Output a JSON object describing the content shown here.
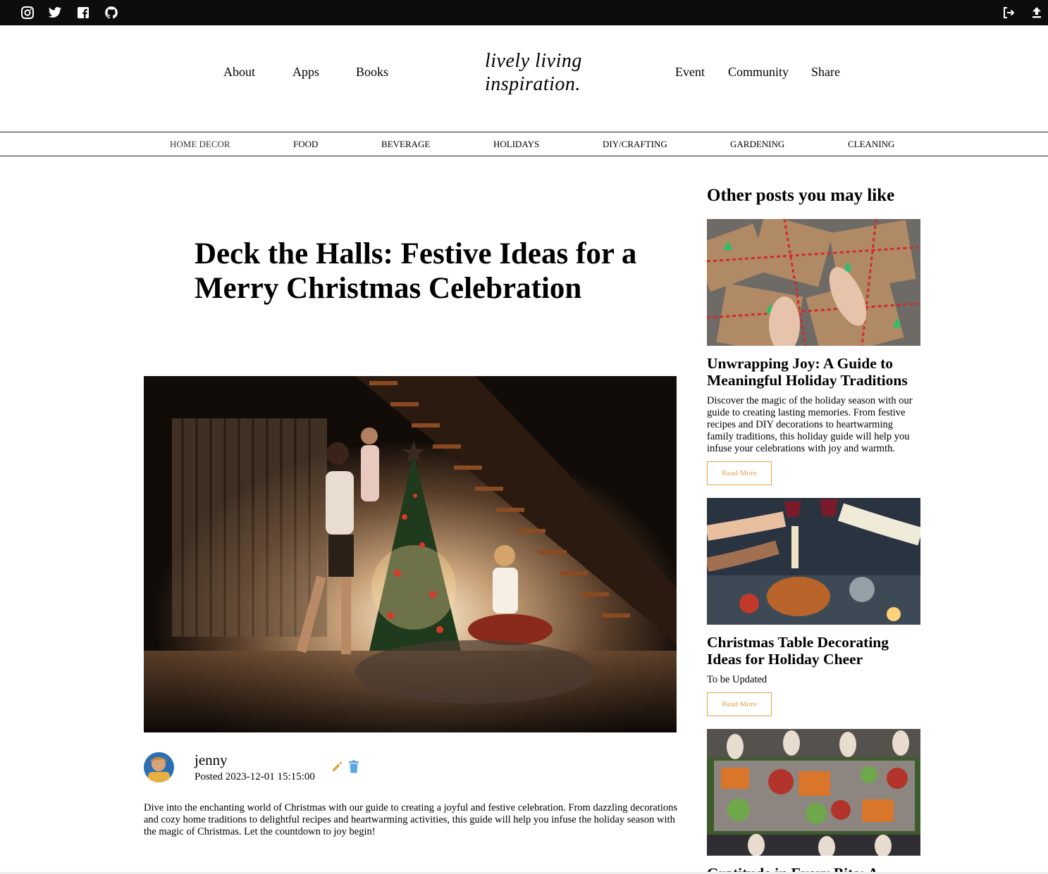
{
  "topbar": {
    "social_icons": [
      "instagram-icon",
      "twitter-icon",
      "facebook-icon",
      "github-icon"
    ],
    "right_icons": [
      "logout-icon",
      "upload-icon"
    ]
  },
  "header": {
    "nav_left": [
      "About",
      "Apps",
      "Books"
    ],
    "logo_line1": "lively living",
    "logo_line2": "inspiration.",
    "nav_right": [
      "Event",
      "Community",
      "Share"
    ]
  },
  "categories": [
    "HOME DECOR",
    "FOOD",
    "BEVERAGE",
    "HOLIDAYS",
    "DIY/CRAFTING",
    "GARDENING",
    "CLEANING"
  ],
  "article": {
    "title": "Deck the Halls: Festive Ideas for a Merry Christmas Celebration",
    "author": "jenny",
    "posted": "Posted 2023-12-01 15:15:00",
    "body": "Dive into the enchanting world of Christmas with our guide to creating a joyful and festive celebration. From dazzling decorations and cozy home traditions to delightful recipes and heartwarming activities, this guide will help you infuse the holiday season with the magic of Christmas. Let the countdown to joy begin!"
  },
  "sidebar": {
    "heading": "Other posts you may like",
    "posts": [
      {
        "title": "Unwrapping Joy: A Guide to Meaningful Holiday Traditions",
        "desc": "Discover the magic of the holiday season with our guide to creating lasting memories. From festive recipes and DIY decorations to heartwarming family traditions, this holiday guide will help you infuse your celebrations with joy and warmth.",
        "button": "Read More"
      },
      {
        "title": "Christmas Table Decorating Ideas for Holiday Cheer",
        "desc": "To be Updated",
        "button": "Read More"
      },
      {
        "title": "Gratitude in Every Bite: A"
      }
    ]
  },
  "colors": {
    "topbar": "#0d0d0d",
    "accent": "#e0a04a",
    "trash_icon": "#5aa9e0"
  }
}
